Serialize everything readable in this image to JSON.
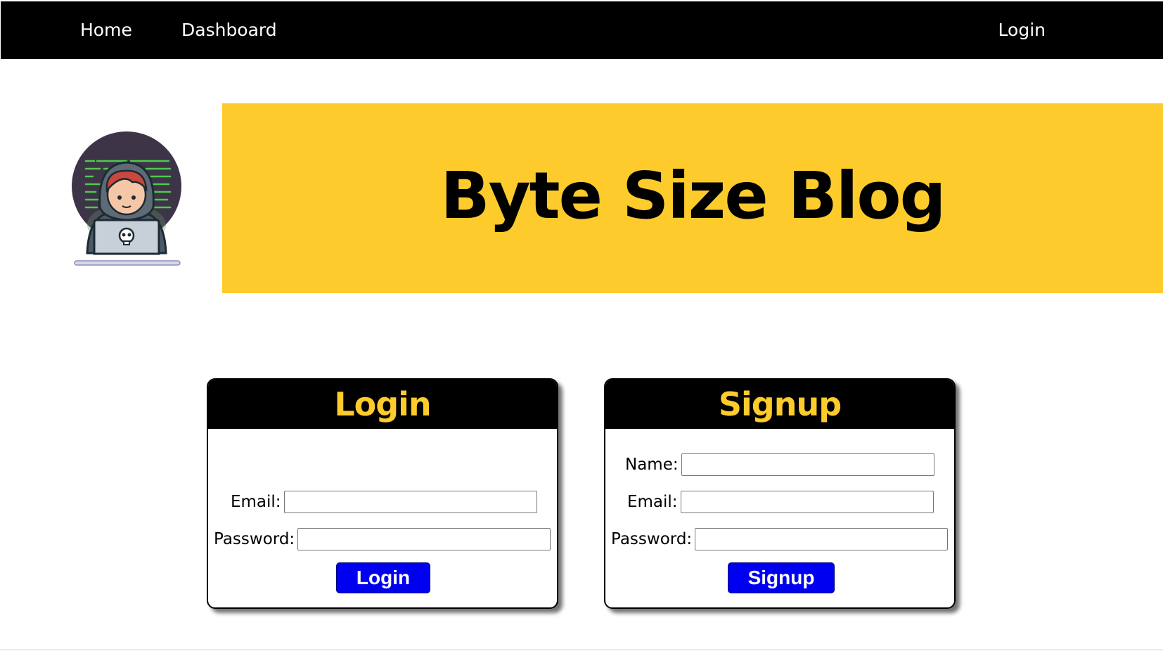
{
  "nav": {
    "home": "Home",
    "dashboard": "Dashboard",
    "login": "Login"
  },
  "banner": {
    "title": "Byte Size Blog"
  },
  "login_card": {
    "title": "Login",
    "email_label": "Email:",
    "email_value": "",
    "password_label": "Password:",
    "password_value": "",
    "button_label": "Login"
  },
  "signup_card": {
    "title": "Signup",
    "name_label": "Name:",
    "name_value": "",
    "email_label": "Email:",
    "email_value": "",
    "password_label": "Password:",
    "password_value": "",
    "button_label": "Signup"
  },
  "icons": {
    "logo": "hacker-laptop-icon"
  },
  "colors": {
    "nav_bg": "#000000",
    "accent_yellow": "#fdcb2b",
    "button_blue": "#0000f0",
    "text": "#000000"
  }
}
